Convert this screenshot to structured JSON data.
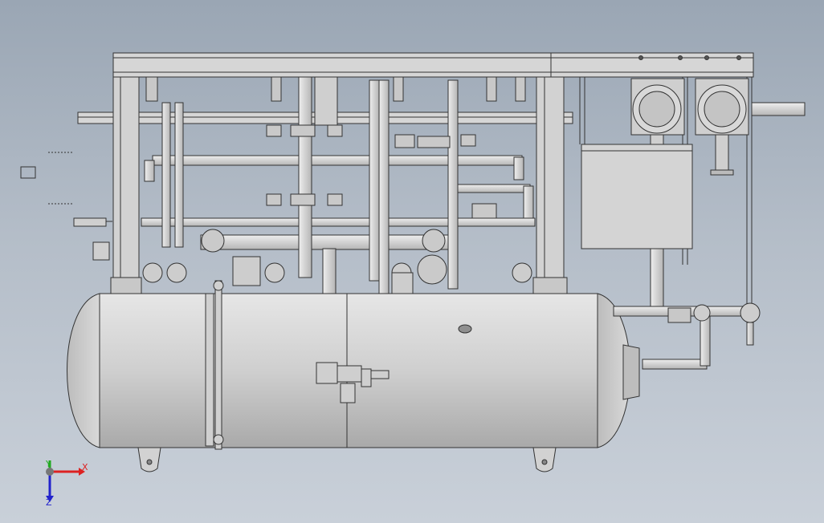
{
  "viewport": {
    "background_top": "#9aa6b4",
    "background_bottom": "#c9d0d9",
    "model_fill": "#d3d3d3",
    "model_stroke": "#3a3a3a"
  },
  "triad": {
    "x_label": "X",
    "y_label": "Y",
    "z_label": "Z",
    "x_color": "#dd2222",
    "y_color": "#22aa22",
    "z_color": "#2222cc"
  }
}
